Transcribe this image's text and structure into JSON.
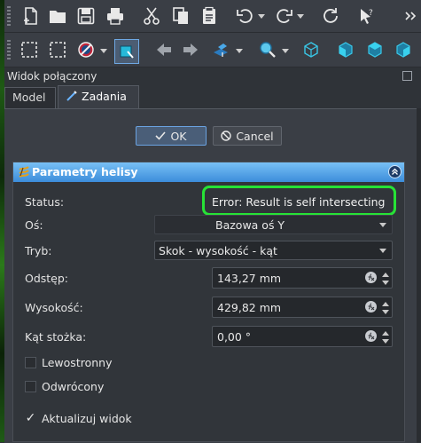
{
  "panel": {
    "title": "Widok połączony"
  },
  "tabs": [
    {
      "label": "Model"
    },
    {
      "label": "Zadania"
    }
  ],
  "dialog": {
    "ok_label": "OK",
    "cancel_label": "Cancel"
  },
  "section": {
    "title": "Parametry helisy"
  },
  "form": {
    "status": {
      "label": "Status:",
      "value": "Error: Result is self intersecting"
    },
    "axis": {
      "label": "Oś:",
      "value": "Bazowa oś Y"
    },
    "mode": {
      "label": "Tryb:",
      "value": "Skok - wysokość - kąt"
    },
    "pitch": {
      "label": "Odstęp:",
      "value": "143,27 mm"
    },
    "height": {
      "label": "Wysokość:",
      "value": "429,82 mm"
    },
    "angle": {
      "label": "Kąt stożka:",
      "value": "0,00 °"
    },
    "left_handed": {
      "label": "Lewostronny",
      "checked": false
    },
    "reversed": {
      "label": "Odwrócony",
      "checked": false
    },
    "update_view": {
      "label": "Aktualizuj widok",
      "checked": true
    }
  },
  "icons": {
    "toolbar_row1": [
      "new-file-icon",
      "open-folder-icon",
      "save-icon",
      "print-icon",
      "cut-icon",
      "copy-icon",
      "paste-icon",
      "undo-icon",
      "redo-icon",
      "refresh-icon",
      "whats-this-icon"
    ],
    "toolbar_row2": [
      "box-select-icon",
      "box-element-select-icon",
      "draw-style-icon",
      "bounding-box-icon",
      "back-arrow-icon",
      "forward-arrow-icon",
      "sync-view-icon",
      "zoom-icon",
      "isometric-icon",
      "front-view-icon",
      "top-view-icon",
      "right-view-icon"
    ]
  },
  "colors": {
    "accent_green": "#27e236",
    "header_blue": "#5aa8ec"
  }
}
